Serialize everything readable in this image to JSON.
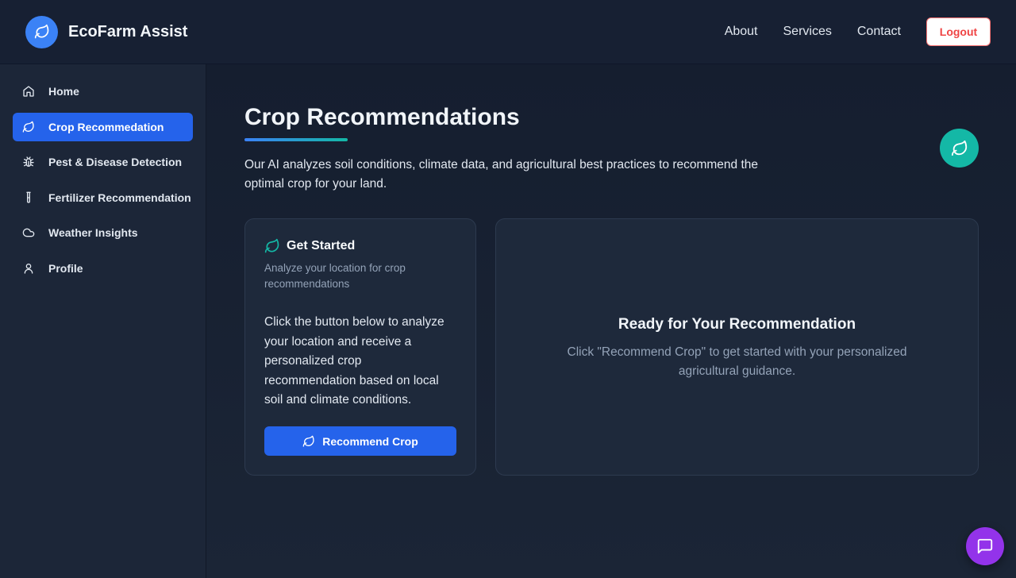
{
  "app": {
    "brand": "EcoFarm Assist"
  },
  "topnav": {
    "links": [
      "About",
      "Services",
      "Contact"
    ],
    "logout_label": "Logout"
  },
  "sidebar": {
    "items": [
      {
        "label": "Home",
        "icon": "home-icon",
        "active": false
      },
      {
        "label": "Crop Recommedation",
        "icon": "leaf-icon",
        "active": true
      },
      {
        "label": "Pest & Disease Detection",
        "icon": "bug-icon",
        "active": false
      },
      {
        "label": "Fertilizer Recommendation",
        "icon": "test-tube-icon",
        "active": false
      },
      {
        "label": "Weather Insights",
        "icon": "cloud-icon",
        "active": false
      },
      {
        "label": "Profile",
        "icon": "user-icon",
        "active": false
      }
    ]
  },
  "main": {
    "title": "Crop Recommendations",
    "intro": "Our AI analyzes soil conditions, climate data, and agricultural best practices to recommend the optimal crop for your land."
  },
  "start_card": {
    "title": "Get Started",
    "subtitle": "Analyze your location for crop recommendations",
    "body": "Click the button below to analyze your location and receive a personalized crop recommendation based on local soil and climate conditions.",
    "button_label": "Recommend Crop"
  },
  "result_card": {
    "title": "Ready for Your Recommendation",
    "text": "Click \"Recommend Crop\" to get started with your personalized agricultural guidance."
  },
  "colors": {
    "accent_blue": "#2563eb",
    "accent_teal": "#14b8a6",
    "logout_red": "#ef4444",
    "chat_purple": "#9333ea"
  }
}
